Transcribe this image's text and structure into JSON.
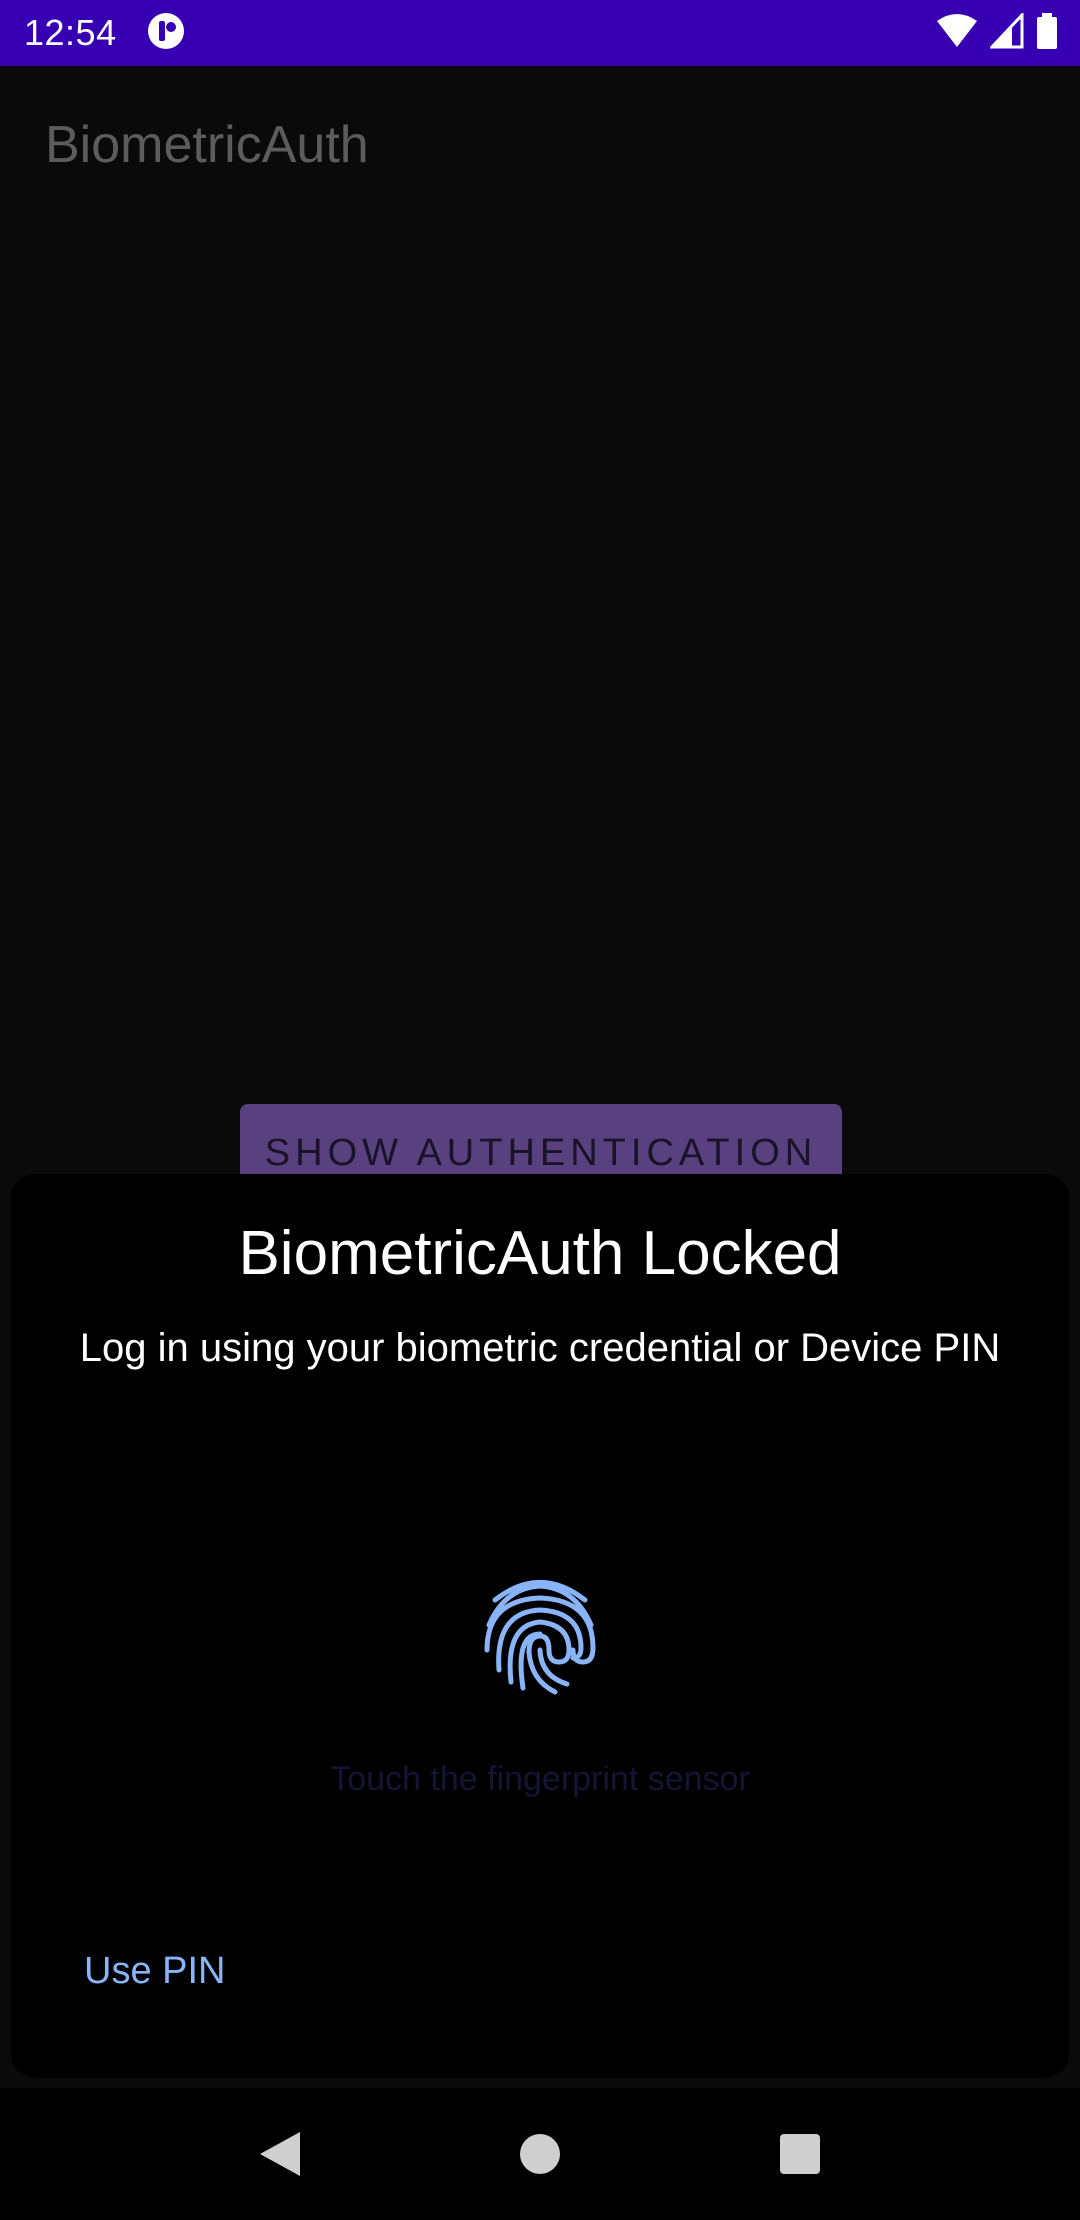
{
  "status_bar": {
    "time": "12:54",
    "icons": [
      "notification-app-icon",
      "wifi-icon",
      "signal-icon",
      "battery-icon"
    ],
    "background": "#3700b3"
  },
  "app": {
    "title": "BiometricAuth",
    "show_auth_label": "SHOW AUTHENTICATION",
    "button_color": "#59417f"
  },
  "dialog": {
    "title": "BiometricAuth Locked",
    "subtitle": "Log in using your biometric credential or Device PIN",
    "hint": "Touch the fingerprint sensor",
    "use_pin_label": "Use PIN",
    "accent": "#8ab4f8",
    "icon": "fingerprint-icon"
  },
  "nav_bar": {
    "icons": [
      "back-icon",
      "home-icon",
      "recents-icon"
    ]
  }
}
